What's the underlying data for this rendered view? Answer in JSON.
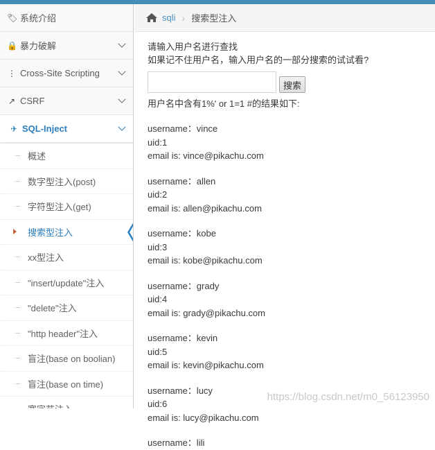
{
  "breadcrumb": {
    "link": "sqli",
    "current": "搜索型注入",
    "separator": "›"
  },
  "sidebar": {
    "items": [
      {
        "label": "系统介绍",
        "icon": "tags-icon",
        "glyph": "🏷"
      },
      {
        "label": "暴力破解",
        "icon": "lock-icon",
        "glyph": "🔒"
      },
      {
        "label": "Cross-Site Scripting",
        "icon": "sitemap-icon",
        "glyph": "⋮"
      },
      {
        "label": "CSRF",
        "icon": "share-icon",
        "glyph": "↗"
      },
      {
        "label": "SQL-Inject",
        "icon": "fighter-jet-icon",
        "glyph": "✈"
      }
    ],
    "subitems": [
      {
        "label": "概述"
      },
      {
        "label": "数字型注入(post)"
      },
      {
        "label": "字符型注入(get)"
      },
      {
        "label": "搜索型注入"
      },
      {
        "label": "xx型注入"
      },
      {
        "label": "\"insert/update\"注入"
      },
      {
        "label": "\"delete\"注入"
      },
      {
        "label": "\"http header\"注入"
      },
      {
        "label": "盲注(base on boolian)"
      },
      {
        "label": "盲注(base on time)"
      },
      {
        "label": "宽字节注入"
      }
    ]
  },
  "main": {
    "prompt1": "请输入用户名进行查找",
    "prompt2": "如果记不住用户名，输入用户名的一部分搜索的试试看?",
    "search_value": "",
    "search_button": "搜索",
    "result_title": "用户名中含有1%' or 1=1 #的结果如下:",
    "records": [
      {
        "username": "username：vince",
        "uid": "uid:1",
        "email": "email is: vince@pikachu.com"
      },
      {
        "username": "username：allen",
        "uid": "uid:2",
        "email": "email is: allen@pikachu.com"
      },
      {
        "username": "username：kobe",
        "uid": "uid:3",
        "email": "email is: kobe@pikachu.com"
      },
      {
        "username": "username：grady",
        "uid": "uid:4",
        "email": "email is: grady@pikachu.com"
      },
      {
        "username": "username：kevin",
        "uid": "uid:5",
        "email": "email is: kevin@pikachu.com"
      },
      {
        "username": "username：lucy",
        "uid": "uid:6",
        "email": "email is: lucy@pikachu.com"
      },
      {
        "username": "username：lili",
        "uid": "",
        "email": ""
      }
    ]
  },
  "watermark": "https://blog.csdn.net/m0_56123950",
  "colors": {
    "accent": "#2b7dbc",
    "topbar": "#438eb9",
    "caret": "#c86139"
  }
}
